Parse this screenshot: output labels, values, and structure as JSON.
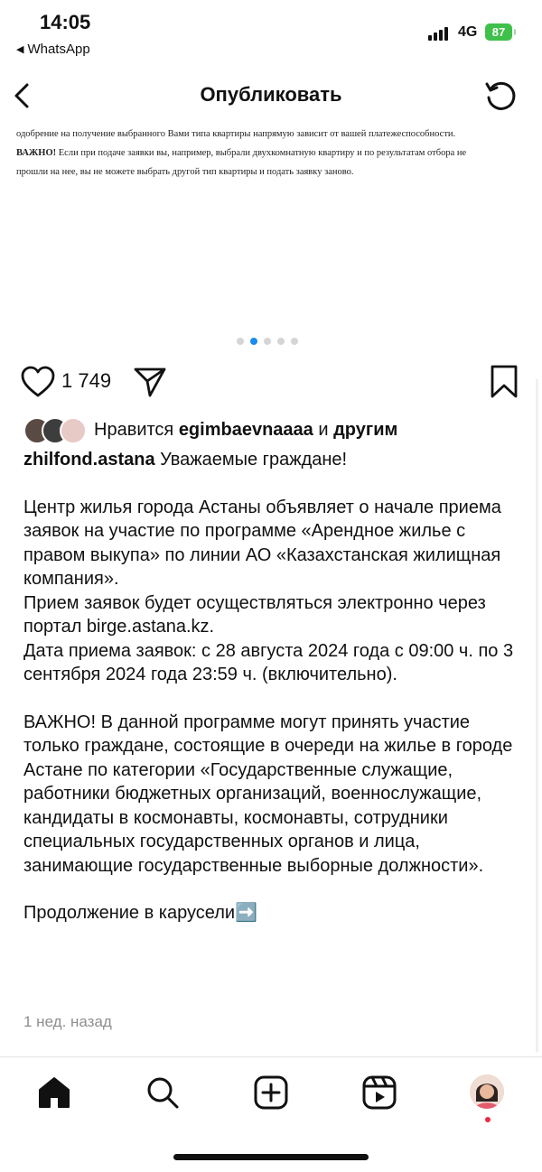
{
  "status_bar": {
    "time": "14:05",
    "back_app": "WhatsApp",
    "network": "4G",
    "battery": "87"
  },
  "header": {
    "title": "Опубликовать"
  },
  "post_image": {
    "line1": "одобрение на получение выбранного Вами типа квартиры напрямую зависит от вашей платежеспособности.",
    "line2_bold": "ВАЖНО!",
    "line2": " Если при подаче заявки вы, например, выбрали двухкомнатную квартиру и по результатам отбора не",
    "line3": "прошли на нее, вы не можете выбрать другой тип квартиры и подать заявку заново.",
    "carousel_count": 5,
    "carousel_active": 2
  },
  "actions": {
    "like_count": "1 749"
  },
  "liked_by": {
    "prefix": "Нравится ",
    "user": "egimbaevnaaaa",
    "middle": " и ",
    "others": "другим"
  },
  "caption": {
    "username": "zhilfond.astana",
    "greeting": " Уважаемые граждане!",
    "p1": "Центр жилья города Астаны объявляет о начале приема заявок на участие по программе «Арендное жилье с правом выкупа» по линии АО «Казахстанская жилищная компания».",
    "p2": "Прием заявок будет осуществляться электронно через портал birge.astana.kz.",
    "p3": "Дата приема заявок: с 28 августа 2024 года с 09:00 ч. по 3 сентября 2024 года 23:59 ч. (включительно).",
    "p4": "ВАЖНО! В данной программе могут принять участие только граждане, состоящие в очереди на жилье в городе Астане по категории «Государственные служащие, работники бюджетных организаций, военнослужащие, кандидаты в космонавты, космонавты, сотрудники специальных государственных органов и лица, занимающие государственные выборные должности».",
    "p5": "Продолжение в карусели",
    "p5_emoji": "➡️"
  },
  "time_ago": "1 нед. назад",
  "colors": {
    "accent": "#1a8bf0",
    "battery": "#3fc04a",
    "notification": "#ed2a43",
    "muted": "#8e8e8e"
  },
  "icons": [
    "back-arrow-icon",
    "reload-icon",
    "heart-icon",
    "send-icon",
    "bookmark-icon",
    "home-icon",
    "search-icon",
    "create-icon",
    "reels-icon"
  ]
}
